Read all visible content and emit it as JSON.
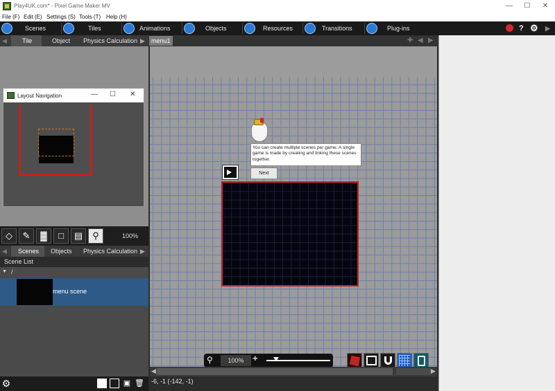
{
  "window": {
    "title": "Play4UK.com* - Pixel Game Maker MV"
  },
  "menu": [
    "File (F)",
    "Edit (E)",
    "Settings (S)",
    "Tools (T)",
    "Help (H)"
  ],
  "toolbar": [
    "Scenes",
    "Tiles",
    "Animations",
    "Objects",
    "Resources",
    "Transitions",
    "Plug-ins"
  ],
  "toolbar_right": {
    "help": "?"
  },
  "left_top_tabs": [
    "Tile",
    "Object",
    "Physics Calculation"
  ],
  "layout_nav": {
    "title": "Layout Navigation",
    "min": "—",
    "max": "☐",
    "close": "✕"
  },
  "tool_zoom": "100%",
  "left_bottom_tabs": [
    "Scenes",
    "Objects",
    "Physics Calculation"
  ],
  "scene_list": {
    "header": "Scene List",
    "folder": "/",
    "items": [
      {
        "name": "menu scene"
      }
    ]
  },
  "center": {
    "scene_tab": "menu1",
    "tooltip": "You can create multiple scenes per game. A single game is made by creating and linking these scenes together.",
    "next_label": "Next",
    "zoom": "100%",
    "coords": "-6, -1 (-142, -1)"
  },
  "colors": {
    "toolbar_bg": "#1a1a1a",
    "selection": "#2e5a88",
    "scene_border": "#c81e1e",
    "grid": "#6f7fae"
  }
}
